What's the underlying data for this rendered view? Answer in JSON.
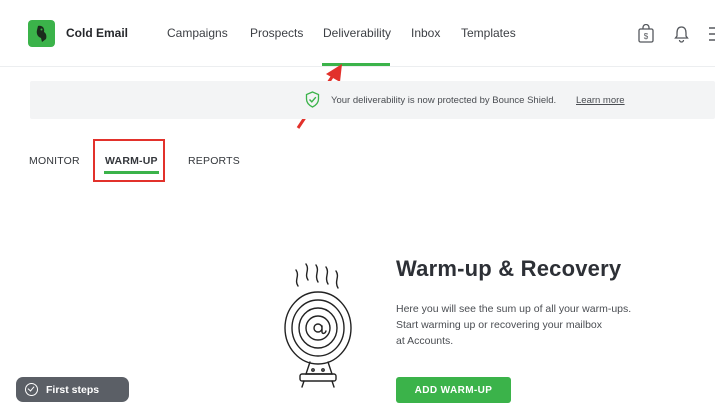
{
  "app": {
    "brand": "Cold Email"
  },
  "nav": {
    "items": [
      {
        "label": "Campaigns"
      },
      {
        "label": "Prospects"
      },
      {
        "label": "Deliverability",
        "active": true
      },
      {
        "label": "Inbox"
      },
      {
        "label": "Templates"
      }
    ]
  },
  "header_icons": [
    "shop-bag-icon",
    "bell-icon"
  ],
  "banner": {
    "text": "Your deliverability is now protected by Bounce Shield.",
    "link": "Learn more",
    "icon": "shield-check-icon"
  },
  "tabs": [
    {
      "label": "MONITOR"
    },
    {
      "label": "WARM-UP",
      "active": true
    },
    {
      "label": "REPORTS"
    }
  ],
  "hero": {
    "title": "Warm-up & Recovery",
    "description": "Here you will see the sum up of all your warm-ups.\nStart warming up or recovering your mailbox\nat Accounts.",
    "cta": "ADD WARM-UP"
  },
  "first_steps": {
    "label": "First steps"
  },
  "colors": {
    "accent": "#3bb34a",
    "annotation": "#e2312b",
    "banner_bg": "#f3f4f5",
    "chip_bg": "#5b5f66"
  }
}
